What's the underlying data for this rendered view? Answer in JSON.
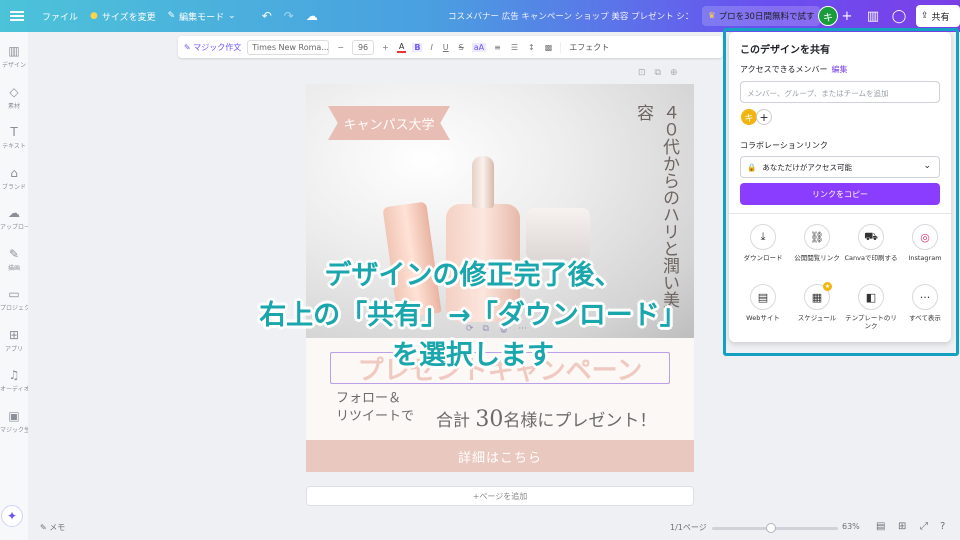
{
  "topbar": {
    "file": "ファイル",
    "resize": "サイズを変更",
    "edit_mode": "編集モード",
    "doc_title": "コスメバナー 広告 キャンペーン ショップ 美容 プレゼント シン...",
    "trial": "プロを30日間無料で試す",
    "avatar_initial": "キ",
    "share": "共有"
  },
  "toolbar": {
    "magic": "マジック作文",
    "font": "Times New Roma...",
    "size": "96",
    "effect": "エフェクト"
  },
  "sidebar": [
    {
      "icon": "design-icon",
      "glyph": "▥",
      "label": "デザイン"
    },
    {
      "icon": "elements-icon",
      "glyph": "◇",
      "label": "素材"
    },
    {
      "icon": "text-icon",
      "glyph": "T",
      "label": "テキスト"
    },
    {
      "icon": "brand-icon",
      "glyph": "⌂",
      "label": "ブランド"
    },
    {
      "icon": "upload-icon",
      "glyph": "☁",
      "label": "アップロード"
    },
    {
      "icon": "draw-icon",
      "glyph": "✎",
      "label": "描画"
    },
    {
      "icon": "projects-icon",
      "glyph": "▭",
      "label": "プロジェクト"
    },
    {
      "icon": "apps-icon",
      "glyph": "⊞",
      "label": "アプリ"
    },
    {
      "icon": "audio-icon",
      "glyph": "♫",
      "label": "オーディオ"
    },
    {
      "icon": "magic-media-icon",
      "glyph": "▣",
      "label": "マジック生成"
    }
  ],
  "design": {
    "ribbon": "キャンパス大学",
    "vertical": "４０代からのハリと潤い美容",
    "campaign": "プレゼントキャンペーン",
    "follow_line1": "フォロー＆",
    "follow_line2": "リツイートで",
    "present_pre": "合計",
    "present_num": "30",
    "present_post": "名様にプレゼント！",
    "details": "詳細はこちら"
  },
  "add_page": "+ページを追加",
  "caption": {
    "line1": "デザインの修正完了後、",
    "line2": "右上の「共有」→「ダウンロード」",
    "line3": "を選択します"
  },
  "share_panel": {
    "title": "このデザインを共有",
    "access_label": "アクセスできるメンバー",
    "edit": "編集",
    "input_placeholder": "メンバー、グループ、またはチームを追加",
    "member_initial": "キ",
    "collab_label": "コラボレーションリンク",
    "access_option": "あなただけがアクセス可能",
    "copy_link": "リンクをコピー",
    "options": [
      {
        "name": "download",
        "icon": "download-icon",
        "glyph": "⤓",
        "label": "ダウンロード"
      },
      {
        "name": "public-link",
        "icon": "link-icon",
        "glyph": "⛓",
        "label": "公開閲覧リンク"
      },
      {
        "name": "print",
        "icon": "truck-icon",
        "glyph": "⛟",
        "label": "Canvaで印刷する"
      },
      {
        "name": "instagram",
        "icon": "instagram-icon",
        "glyph": "◎",
        "label": "Instagram"
      },
      {
        "name": "website",
        "icon": "website-icon",
        "glyph": "▤",
        "label": "Webサイト"
      },
      {
        "name": "schedule",
        "icon": "calendar-icon",
        "glyph": "▦",
        "label": "スケジュール"
      },
      {
        "name": "template-link",
        "icon": "template-icon",
        "glyph": "◧",
        "label": "テンプレートのリンク"
      },
      {
        "name": "show-all",
        "icon": "more-icon",
        "glyph": "···",
        "label": "すべて表示"
      }
    ]
  },
  "bottombar": {
    "memo": "メモ",
    "pages": "1/1ページ",
    "zoom": "63%",
    "zoom_level": 0.63
  },
  "colors": {
    "accent": "#8b3dff",
    "caption": "#1aa6ad",
    "highlight": "#14a0c0"
  }
}
